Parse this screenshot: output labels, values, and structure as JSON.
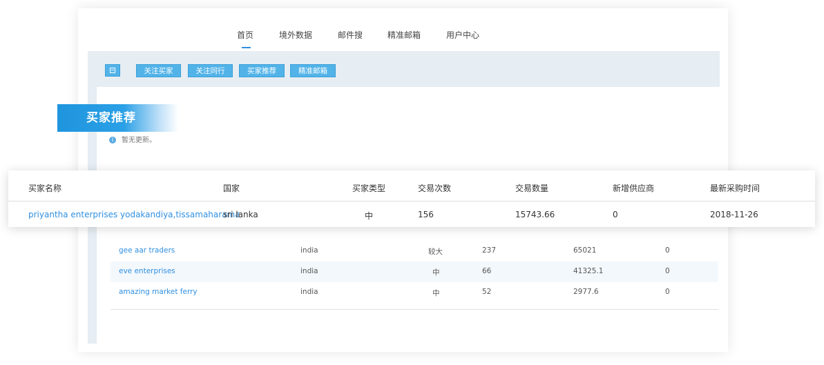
{
  "nav": {
    "items": [
      "首页",
      "境外数据",
      "邮件搜",
      "精准邮箱",
      "用户中心"
    ]
  },
  "toolbar": {
    "buttons": [
      "关注买家",
      "关注同行",
      "买家推荐",
      "精准邮箱"
    ]
  },
  "banner": {
    "title": "买家推荐"
  },
  "notice": {
    "text": "暂无更新。"
  },
  "table": {
    "headers": [
      "买家名称",
      "国家",
      "买家类型",
      "交易次数",
      "交易数量",
      "新增供应商",
      "最新采购时间"
    ],
    "highlight_row": [
      "priyantha enterprises yodakandiya,tissamaharama",
      "sri lanka",
      "中",
      "156",
      "15743.66",
      "0",
      "2018-11-26"
    ],
    "rows": [
      [
        "gee aar traders",
        "india",
        "较大",
        "237",
        "65021",
        "0"
      ],
      [
        "eve enterprises",
        "india",
        "中",
        "66",
        "41325.1",
        "0"
      ],
      [
        "amazing market ferry",
        "india",
        "中",
        "52",
        "2977.6",
        "0"
      ]
    ]
  },
  "colors": {
    "accent": "#2e8fe0",
    "button": "#52b3e8",
    "panel": "#e6edf3"
  },
  "icons": {
    "toolbar_first": "list-icon",
    "notice": "info-icon"
  }
}
